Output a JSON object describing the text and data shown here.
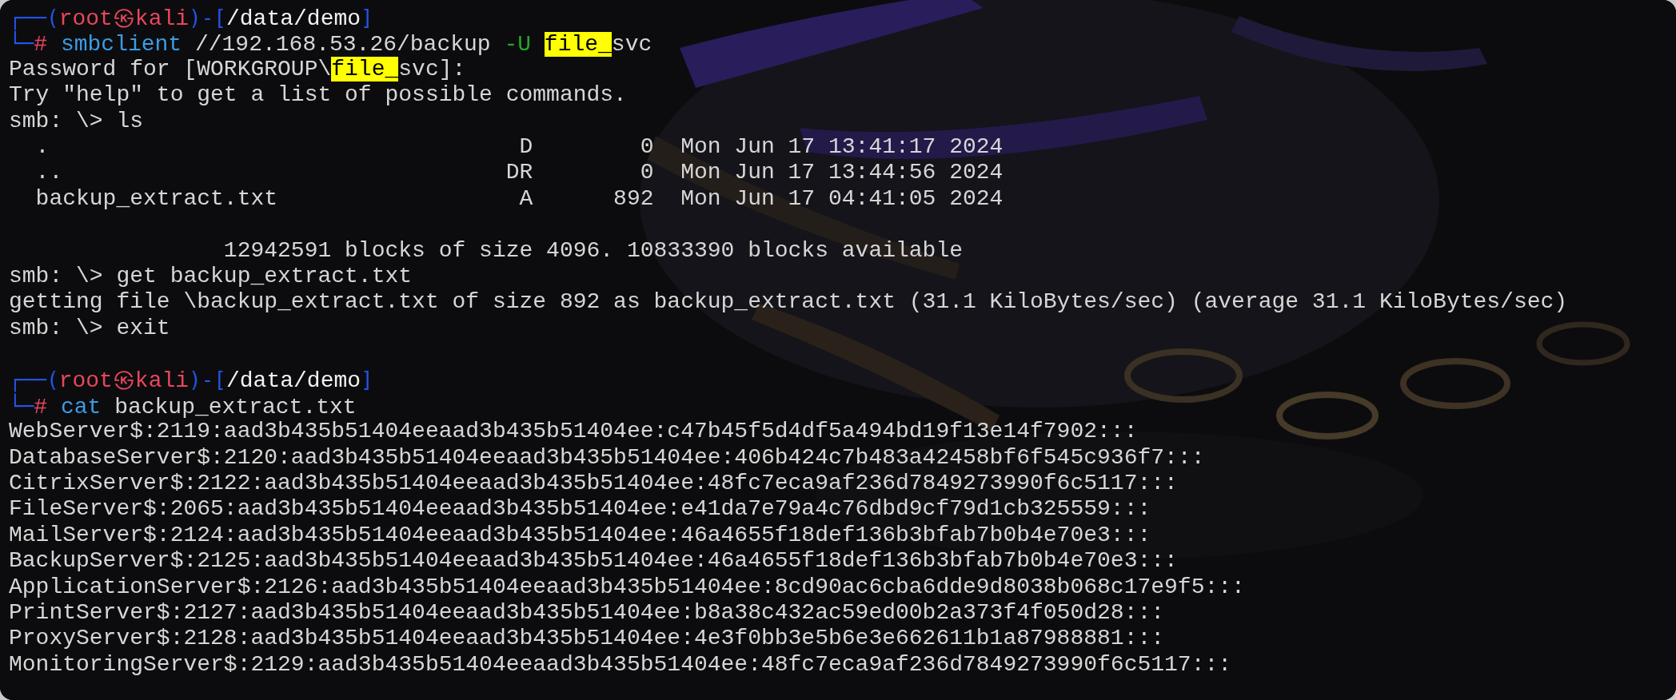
{
  "lines": [
    {
      "kind": "text",
      "segments": [
        {
          "kind": "frame",
          "text": "┌──("
        },
        {
          "kind": "user",
          "text": "root㉿kali"
        },
        {
          "kind": "frame",
          "text": ")-["
        },
        {
          "kind": "path",
          "text": "/data/demo"
        },
        {
          "kind": "frame",
          "text": "]"
        }
      ]
    },
    {
      "kind": "text",
      "segments": [
        {
          "kind": "frame",
          "text": "└─"
        },
        {
          "kind": "user",
          "text": "# "
        },
        {
          "kind": "command",
          "text": "smbclient"
        },
        {
          "kind": "plain",
          "text": " //192.168.53.26/backup "
        },
        {
          "kind": "flag",
          "text": "-U "
        },
        {
          "kind": "highlight",
          "text": "file_"
        },
        {
          "kind": "plain",
          "text": "svc"
        }
      ]
    },
    {
      "kind": "text",
      "segments": [
        {
          "kind": "plain",
          "text": "Password for [WORKGROUP\\"
        },
        {
          "kind": "highlight",
          "text": "file_"
        },
        {
          "kind": "plain",
          "text": "svc]:"
        }
      ]
    },
    {
      "kind": "text",
      "segments": [
        {
          "kind": "plain",
          "text": "Try \"help\" to get a list of possible commands."
        }
      ]
    },
    {
      "kind": "text",
      "segments": [
        {
          "kind": "plain",
          "text": "smb: \\> ls"
        }
      ]
    },
    {
      "kind": "text",
      "segments": [
        {
          "kind": "plain",
          "text": "  .                                   D        0  Mon Jun 17 13:41:17 2024"
        }
      ]
    },
    {
      "kind": "text",
      "segments": [
        {
          "kind": "plain",
          "text": "  ..                                 DR        0  Mon Jun 17 13:44:56 2024"
        }
      ]
    },
    {
      "kind": "text",
      "segments": [
        {
          "kind": "plain",
          "text": "  backup_extract.txt                  A      892  Mon Jun 17 04:41:05 2024"
        }
      ]
    },
    {
      "kind": "blank"
    },
    {
      "kind": "text",
      "segments": [
        {
          "kind": "plain",
          "text": "                12942591 blocks of size 4096. 10833390 blocks available"
        }
      ]
    },
    {
      "kind": "text",
      "segments": [
        {
          "kind": "plain",
          "text": "smb: \\> get backup_extract.txt"
        }
      ]
    },
    {
      "kind": "text",
      "segments": [
        {
          "kind": "plain",
          "text": "getting file \\backup_extract.txt of size 892 as backup_extract.txt (31.1 KiloBytes/sec) (average 31.1 KiloBytes/sec)"
        }
      ]
    },
    {
      "kind": "text",
      "segments": [
        {
          "kind": "plain",
          "text": "smb: \\> exit"
        }
      ]
    },
    {
      "kind": "blank"
    },
    {
      "kind": "text",
      "segments": [
        {
          "kind": "frame",
          "text": "┌──("
        },
        {
          "kind": "user",
          "text": "root㉿kali"
        },
        {
          "kind": "frame",
          "text": ")-["
        },
        {
          "kind": "path",
          "text": "/data/demo"
        },
        {
          "kind": "frame",
          "text": "]"
        }
      ]
    },
    {
      "kind": "text",
      "segments": [
        {
          "kind": "frame",
          "text": "└─"
        },
        {
          "kind": "user",
          "text": "# "
        },
        {
          "kind": "command",
          "text": "cat"
        },
        {
          "kind": "plain",
          "text": " backup_extract.txt"
        }
      ]
    },
    {
      "kind": "text",
      "segments": [
        {
          "kind": "plain",
          "text": "WebServer$:2119:aad3b435b51404eeaad3b435b51404ee:c47b45f5d4df5a494bd19f13e14f7902:::"
        }
      ]
    },
    {
      "kind": "text",
      "segments": [
        {
          "kind": "plain",
          "text": "DatabaseServer$:2120:aad3b435b51404eeaad3b435b51404ee:406b424c7b483a42458bf6f545c936f7:::"
        }
      ]
    },
    {
      "kind": "text",
      "segments": [
        {
          "kind": "plain",
          "text": "CitrixServer$:2122:aad3b435b51404eeaad3b435b51404ee:48fc7eca9af236d7849273990f6c5117:::"
        }
      ]
    },
    {
      "kind": "text",
      "segments": [
        {
          "kind": "plain",
          "text": "FileServer$:2065:aad3b435b51404eeaad3b435b51404ee:e41da7e79a4c76dbd9cf79d1cb325559:::"
        }
      ]
    },
    {
      "kind": "text",
      "segments": [
        {
          "kind": "plain",
          "text": "MailServer$:2124:aad3b435b51404eeaad3b435b51404ee:46a4655f18def136b3bfab7b0b4e70e3:::"
        }
      ]
    },
    {
      "kind": "text",
      "segments": [
        {
          "kind": "plain",
          "text": "BackupServer$:2125:aad3b435b51404eeaad3b435b51404ee:46a4655f18def136b3bfab7b0b4e70e3:::"
        }
      ]
    },
    {
      "kind": "text",
      "segments": [
        {
          "kind": "plain",
          "text": "ApplicationServer$:2126:aad3b435b51404eeaad3b435b51404ee:8cd90ac6cba6dde9d8038b068c17e9f5:::"
        }
      ]
    },
    {
      "kind": "text",
      "segments": [
        {
          "kind": "plain",
          "text": "PrintServer$:2127:aad3b435b51404eeaad3b435b51404ee:b8a38c432ac59ed00b2a373f4f050d28:::"
        }
      ]
    },
    {
      "kind": "text",
      "segments": [
        {
          "kind": "plain",
          "text": "ProxyServer$:2128:aad3b435b51404eeaad3b435b51404ee:4e3f0bb3e5b6e3e662611b1a87988881:::"
        }
      ]
    },
    {
      "kind": "text",
      "segments": [
        {
          "kind": "plain",
          "text": "MonitoringServer$:2129:aad3b435b51404eeaad3b435b51404ee:48fc7eca9af236d7849273990f6c5117:::"
        }
      ]
    }
  ]
}
